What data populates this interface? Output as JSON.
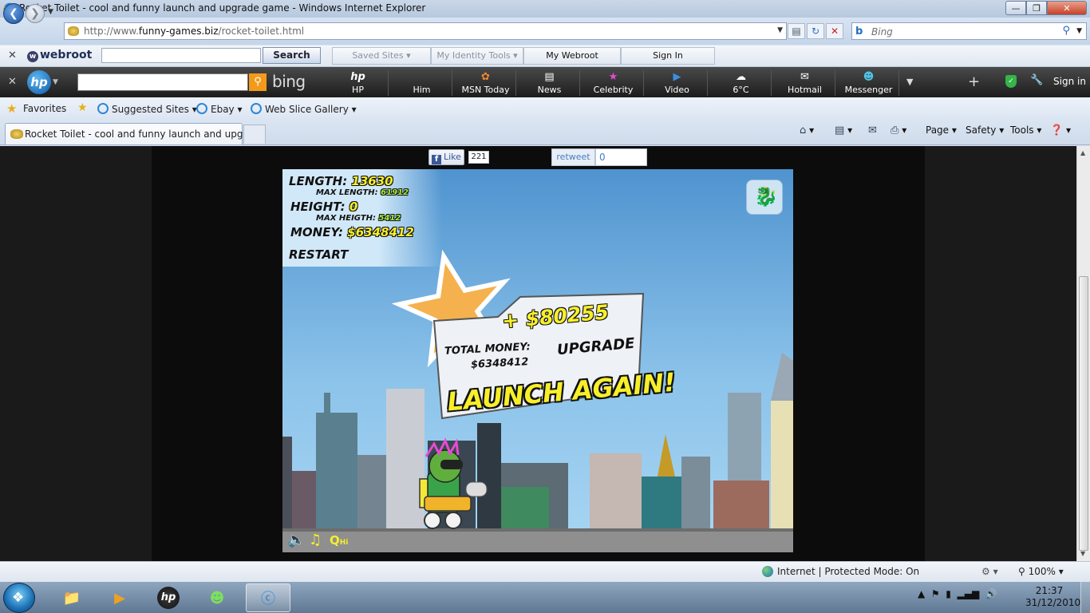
{
  "window": {
    "title": "Rocket Toilet - cool and funny launch and upgrade game - Windows Internet Explorer",
    "minimize_icon": "minimize-icon",
    "maximize_icon": "maximize-icon",
    "close_icon": "close-icon"
  },
  "address_bar": {
    "url_prefix": "http://www.",
    "url_domain": "funny-games.biz",
    "url_path": "/rocket-toilet.html",
    "search_placeholder": "Bing"
  },
  "webroot_toolbar": {
    "brand": "webroot",
    "search_button": "Search",
    "saved_sites": "Saved Sites",
    "identity_tools": "My Identity Tools",
    "my_webroot": "My Webroot",
    "sign_in": "Sign In"
  },
  "hp_toolbar": {
    "brand": "hp",
    "bing_logo": "bing",
    "items": [
      {
        "label": "HP",
        "icon": "hp-icon"
      },
      {
        "label": "Him",
        "icon": "him-icon"
      },
      {
        "label": "MSN Today",
        "icon": "msn-butterfly-icon"
      },
      {
        "label": "News",
        "icon": "news-icon"
      },
      {
        "label": "Celebrity",
        "icon": "celebrity-star-icon"
      },
      {
        "label": "Video",
        "icon": "video-play-icon"
      },
      {
        "label": "6°C",
        "icon": "weather-cloud-icon"
      },
      {
        "label": "Hotmail",
        "icon": "mail-icon"
      },
      {
        "label": "Messenger",
        "icon": "messenger-icon"
      }
    ],
    "sign_in": "Sign in"
  },
  "favorites_bar": {
    "favorites_label": "Favorites",
    "links": [
      "Suggested Sites",
      "Ebay",
      "Web Slice Gallery"
    ]
  },
  "tabs": {
    "active_title": "Rocket Toilet - cool and funny launch and upgra..."
  },
  "command_bar": {
    "page": "Page",
    "safety": "Safety",
    "tools": "Tools"
  },
  "social": {
    "like_label": "Like",
    "like_count": "221",
    "retweet_label": "retweet",
    "retweet_count": "0"
  },
  "game": {
    "length_label": "LENGTH:",
    "length_value": "13630",
    "max_length_label": "MAX LENGTH:",
    "max_length_value": "61912",
    "height_label": "HEIGHT:",
    "height_value": "0",
    "max_height_label": "MAX HEIGTH:",
    "max_height_value": "5412",
    "money_label": "MONEY:",
    "money_value": "$6348412",
    "restart": "RESTART",
    "reward_gain": "+ $80255",
    "total_money_label": "TOTAL MONEY:",
    "total_money_value": "$6348412",
    "upgrade": "UPGRADE",
    "launch_again": "LAUNCH AGAIN!",
    "quality_q": "Q",
    "quality_level": "Hi"
  },
  "status_bar": {
    "zone": "Internet | Protected Mode: On",
    "zoom": "100%"
  },
  "taskbar": {
    "time": "21:37",
    "date": "31/12/2010"
  }
}
